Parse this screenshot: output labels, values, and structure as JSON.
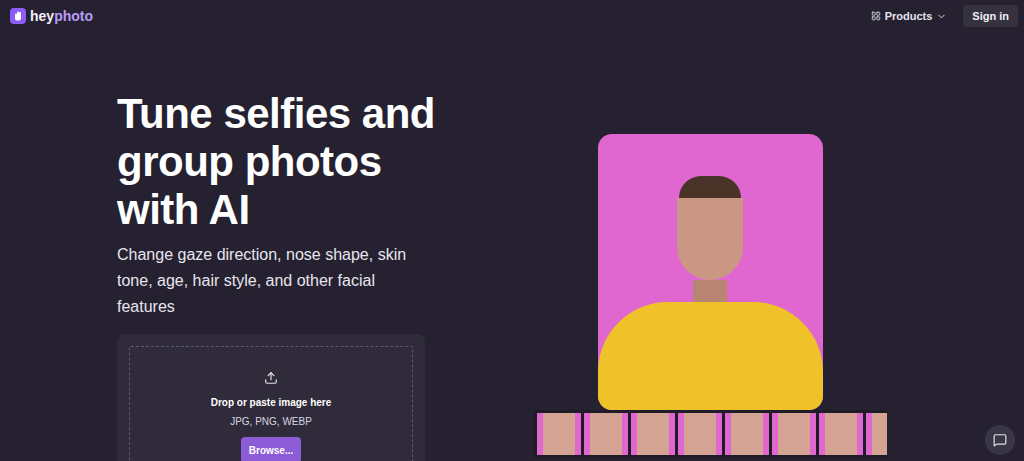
{
  "header": {
    "logo": {
      "prefix": "hey",
      "suffix": "photo"
    },
    "nav": {
      "label": "Products",
      "expanded": false
    },
    "sign_in": "Sign in"
  },
  "hero": {
    "title": "Tune selfies and group photos with AI",
    "subtitle": "Change gaze direction, nose shape, skin tone, age, hair style, and other facial features"
  },
  "upload": {
    "prompt": "Drop or paste image here",
    "formats": "JPG, PNG, WEBP",
    "button": "Browse..."
  }
}
